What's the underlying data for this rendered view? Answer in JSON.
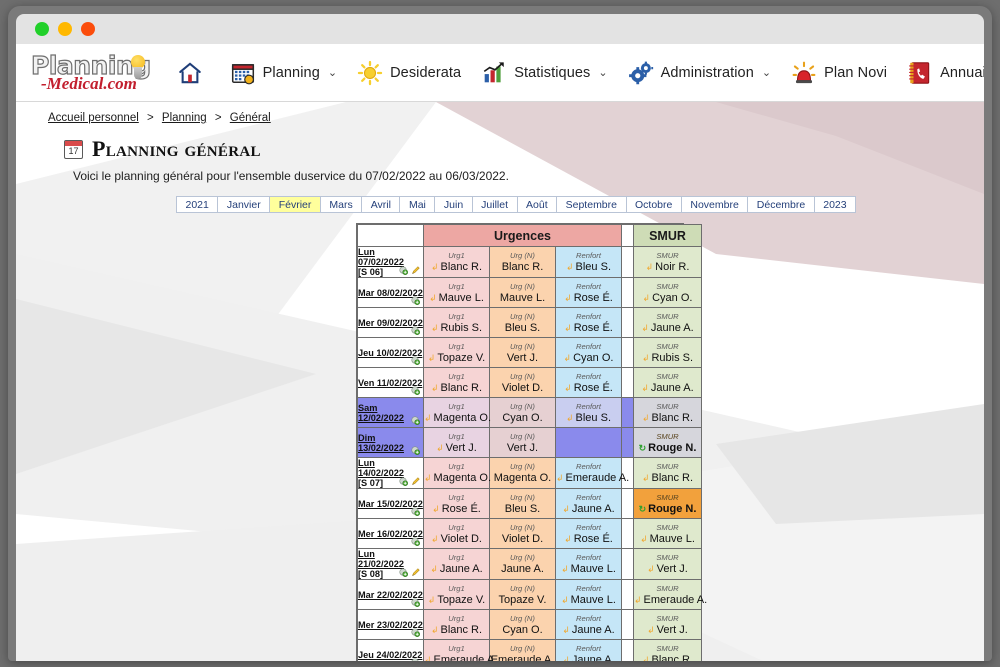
{
  "window": {
    "dots": [
      "close-green",
      "minimize-yellow",
      "maximize-red"
    ]
  },
  "brand": {
    "line1": "Planning",
    "line2": "-Medical.com"
  },
  "nav": {
    "items": [
      {
        "label": "",
        "icon": "home-icon",
        "caret": ""
      },
      {
        "label": "Planning",
        "icon": "calendar-icon",
        "caret": "⌄"
      },
      {
        "label": "Desiderata",
        "icon": "sun-icon",
        "caret": ""
      },
      {
        "label": "Statistiques",
        "icon": "chart-icon",
        "caret": "⌄"
      },
      {
        "label": "Administration",
        "icon": "gears-icon",
        "caret": "⌄"
      },
      {
        "label": "Plan Novi",
        "icon": "siren-icon",
        "caret": ""
      },
      {
        "label": "Annuaire",
        "icon": "phonebook-icon",
        "caret": ""
      }
    ],
    "help_icon": "help-icon",
    "account_icon": "user-account-icon"
  },
  "breadcrumb": {
    "items": [
      "Accueil personnel",
      "Planning",
      "Général"
    ],
    "separator": ">"
  },
  "page": {
    "title": "Planning général",
    "description": "Voici le planning général pour l'ensemble duservice du 07/02/2022 au 06/03/2022.",
    "calendar_icon": "calendar-17-icon"
  },
  "month_tabs": {
    "items": [
      "2021",
      "Janvier",
      "Février",
      "Mars",
      "Avril",
      "Mai",
      "Juin",
      "Juillet",
      "Août",
      "Septembre",
      "Octobre",
      "Novembre",
      "Décembre",
      "2023"
    ],
    "active": "Février"
  },
  "planning": {
    "groups": [
      {
        "label": "",
        "key": "date"
      },
      {
        "label": "Urgences",
        "key": "urgences",
        "color": "#eda7a3"
      },
      {
        "label": "",
        "key": "gap"
      },
      {
        "label": "SMUR",
        "key": "smur",
        "color": "#cedcb6"
      }
    ],
    "slot_kinds": {
      "u1": "Urg1",
      "un": "Urg (N)",
      "ren": "Renfort",
      "smur": "SMUR"
    },
    "rows": [
      {
        "day": "Lun",
        "date": "07/02/2022",
        "week": "[S 06]",
        "weekend": false,
        "week_start": true,
        "icons": [
          "add-icon",
          "edit-icon"
        ],
        "u1": {
          "name": "Blanc R.",
          "mark": "arrow"
        },
        "un": {
          "name": "Blanc R.",
          "mark": "none"
        },
        "ren": {
          "name": "Bleu S.",
          "mark": "arrow"
        },
        "smur": {
          "name": "Noir R.",
          "mark": "arrow"
        }
      },
      {
        "day": "Mar",
        "date": "08/02/2022",
        "week": "",
        "weekend": false,
        "icons": [
          "add-icon"
        ],
        "u1": {
          "name": "Mauve L.",
          "mark": "arrow"
        },
        "un": {
          "name": "Mauve L.",
          "mark": "none"
        },
        "ren": {
          "name": "Rose É.",
          "mark": "arrow"
        },
        "smur": {
          "name": "Cyan O.",
          "mark": "arrow"
        }
      },
      {
        "day": "Mer",
        "date": "09/02/2022",
        "week": "",
        "weekend": false,
        "icons": [
          "add-icon"
        ],
        "u1": {
          "name": "Rubis S.",
          "mark": "arrow"
        },
        "un": {
          "name": "Bleu S.",
          "mark": "none"
        },
        "ren": {
          "name": "Rose É.",
          "mark": "arrow"
        },
        "smur": {
          "name": "Jaune A.",
          "mark": "arrow"
        }
      },
      {
        "day": "Jeu",
        "date": "10/02/2022",
        "week": "",
        "weekend": false,
        "icons": [
          "add-icon"
        ],
        "u1": {
          "name": "Topaze V.",
          "mark": "arrow"
        },
        "un": {
          "name": "Vert J.",
          "mark": "none"
        },
        "ren": {
          "name": "Cyan O.",
          "mark": "arrow"
        },
        "smur": {
          "name": "Rubis S.",
          "mark": "arrow"
        }
      },
      {
        "day": "Ven",
        "date": "11/02/2022",
        "week": "",
        "weekend": false,
        "icons": [
          "add-icon"
        ],
        "u1": {
          "name": "Blanc R.",
          "mark": "arrow"
        },
        "un": {
          "name": "Violet D.",
          "mark": "none"
        },
        "ren": {
          "name": "Rose É.",
          "mark": "arrow"
        },
        "smur": {
          "name": "Jaune A.",
          "mark": "arrow"
        }
      },
      {
        "day": "Sam",
        "date": "12/02/2022",
        "week": "",
        "weekend": true,
        "icons": [
          "add-icon"
        ],
        "u1": {
          "name": "Magenta O.",
          "mark": "arrow"
        },
        "un": {
          "name": "Cyan O.",
          "mark": "none"
        },
        "ren": {
          "name": "Bleu S.",
          "mark": "arrow"
        },
        "smur": {
          "name": "Blanc R.",
          "mark": "arrow"
        }
      },
      {
        "day": "Dim",
        "date": "13/02/2022",
        "week": "",
        "weekend": true,
        "icons": [
          "add-icon"
        ],
        "u1": {
          "name": "Vert J.",
          "mark": "arrow"
        },
        "un": {
          "name": "Vert J.",
          "mark": "none"
        },
        "ren": {
          "name": "",
          "mark": "none",
          "empty": true
        },
        "smur": {
          "name": "Rouge N.",
          "mark": "recycle",
          "alert": true
        }
      },
      {
        "day": "Lun",
        "date": "14/02/2022",
        "week": "[S 07]",
        "weekend": false,
        "week_start": true,
        "icons": [
          "add-icon",
          "edit-icon"
        ],
        "u1": {
          "name": "Magenta O.",
          "mark": "arrow"
        },
        "un": {
          "name": "Magenta O.",
          "mark": "none"
        },
        "ren": {
          "name": "Emeraude A.",
          "mark": "arrow"
        },
        "smur": {
          "name": "Blanc R.",
          "mark": "arrow"
        }
      },
      {
        "day": "Mar",
        "date": "15/02/2022",
        "week": "",
        "weekend": false,
        "icons": [
          "add-icon"
        ],
        "u1": {
          "name": "Rose É.",
          "mark": "arrow"
        },
        "un": {
          "name": "Bleu S.",
          "mark": "none"
        },
        "ren": {
          "name": "Jaune A.",
          "mark": "arrow"
        },
        "smur": {
          "name": "Rouge N.",
          "mark": "recycle",
          "alert": true
        }
      },
      {
        "day": "Mer",
        "date": "16/02/2022",
        "week": "",
        "weekend": false,
        "icons": [
          "add-icon"
        ],
        "u1": {
          "name": "Violet D.",
          "mark": "arrow"
        },
        "un": {
          "name": "Violet D.",
          "mark": "none"
        },
        "ren": {
          "name": "Rose É.",
          "mark": "arrow"
        },
        "smur": {
          "name": "Mauve L.",
          "mark": "arrow"
        }
      },
      {
        "day": "Lun",
        "date": "21/02/2022",
        "week": "[S 08]",
        "weekend": false,
        "week_start": true,
        "icons": [
          "add-icon",
          "edit-icon"
        ],
        "u1": {
          "name": "Jaune A.",
          "mark": "arrow"
        },
        "un": {
          "name": "Jaune A.",
          "mark": "none"
        },
        "ren": {
          "name": "Mauve L.",
          "mark": "arrow"
        },
        "smur": {
          "name": "Vert J.",
          "mark": "arrow"
        }
      },
      {
        "day": "Mar",
        "date": "22/02/2022",
        "week": "",
        "weekend": false,
        "icons": [
          "add-icon"
        ],
        "u1": {
          "name": "Topaze V.",
          "mark": "arrow"
        },
        "un": {
          "name": "Topaze V.",
          "mark": "none"
        },
        "ren": {
          "name": "Mauve L.",
          "mark": "arrow"
        },
        "smur": {
          "name": "Emeraude A.",
          "mark": "arrow"
        }
      },
      {
        "day": "Mer",
        "date": "23/02/2022",
        "week": "",
        "weekend": false,
        "icons": [
          "add-icon"
        ],
        "u1": {
          "name": "Blanc R.",
          "mark": "arrow"
        },
        "un": {
          "name": "Cyan O.",
          "mark": "none"
        },
        "ren": {
          "name": "Jaune A.",
          "mark": "arrow"
        },
        "smur": {
          "name": "Vert J.",
          "mark": "arrow"
        }
      },
      {
        "day": "Jeu",
        "date": "24/02/2022",
        "week": "",
        "weekend": false,
        "icons": [
          "add-icon"
        ],
        "u1": {
          "name": "Emeraude A.",
          "mark": "arrow"
        },
        "un": {
          "name": "Emeraude A.",
          "mark": "none"
        },
        "ren": {
          "name": "Jaune A.",
          "mark": "arrow"
        },
        "smur": {
          "name": "Blanc R.",
          "mark": "arrow"
        }
      }
    ]
  },
  "colors": {
    "urgences_header": "#eda7a3",
    "smur_header": "#cedcb6",
    "urg1_cell": "#f6d4d4",
    "urgn_cell": "#fbd3ae",
    "renfort_cell": "#c5e6f7",
    "smur_cell": "#dfe9cd",
    "weekend_date": "#8a8aec",
    "alert_cell": "#f2a13c",
    "active_tab": "#ffff9c",
    "link": "#25407a"
  }
}
